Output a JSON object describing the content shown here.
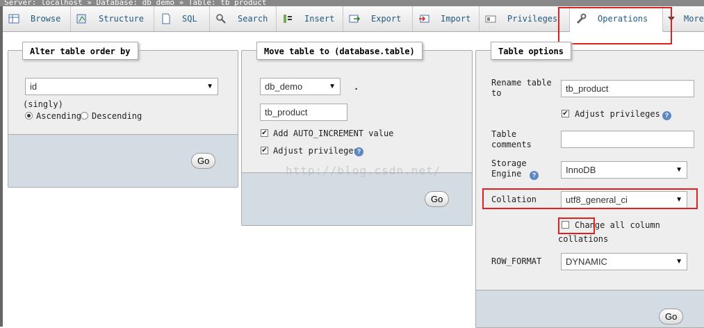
{
  "breadcrumb": "Server: localhost  »  Database: db_demo  »  Table: tb_product",
  "tabs": [
    {
      "label": "Browse",
      "icon": "browse-icon"
    },
    {
      "label": "Structure",
      "icon": "structure-icon"
    },
    {
      "label": "SQL",
      "icon": "sql-icon"
    },
    {
      "label": "Search",
      "icon": "search-icon"
    },
    {
      "label": "Insert",
      "icon": "insert-icon"
    },
    {
      "label": "Export",
      "icon": "export-icon"
    },
    {
      "label": "Import",
      "icon": "import-icon"
    },
    {
      "label": "Privileges",
      "icon": "privileges-icon"
    },
    {
      "label": "Operations",
      "icon": "wrench-icon"
    },
    {
      "label": "More",
      "icon": "caret-down-icon"
    }
  ],
  "order_panel": {
    "legend": "Alter table order by",
    "column": "id",
    "singly": "(singly)",
    "ascending": "Ascending",
    "descending": "Descending",
    "go": "Go"
  },
  "move_panel": {
    "legend": "Move table to (database.table)",
    "database": "db_demo",
    "dot": ".",
    "table": "tb_product",
    "auto_increment": "Add AUTO_INCREMENT value",
    "adjust": "Adjust privileges",
    "go": "Go"
  },
  "options_panel": {
    "legend": "Table options",
    "rename_label": "Rename table to",
    "rename_value": "tb_product",
    "adjust": "Adjust privileges",
    "comments_label": "Table comments",
    "comments_value": "",
    "engine_label": "Storage Engine",
    "engine_value": "InnoDB",
    "collation_label": "Collation",
    "collation_value": "utf8_general_ci",
    "change_all_1": "Change all column",
    "change_all_2": "collations",
    "row_format_label": "ROW_FORMAT",
    "row_format_value": "DYNAMIC",
    "go": "Go"
  },
  "watermark": "http://blog.csdn.net/",
  "colors": {
    "highlight": "#e02020",
    "footer": "#d3dce3",
    "link": "#235a81"
  }
}
